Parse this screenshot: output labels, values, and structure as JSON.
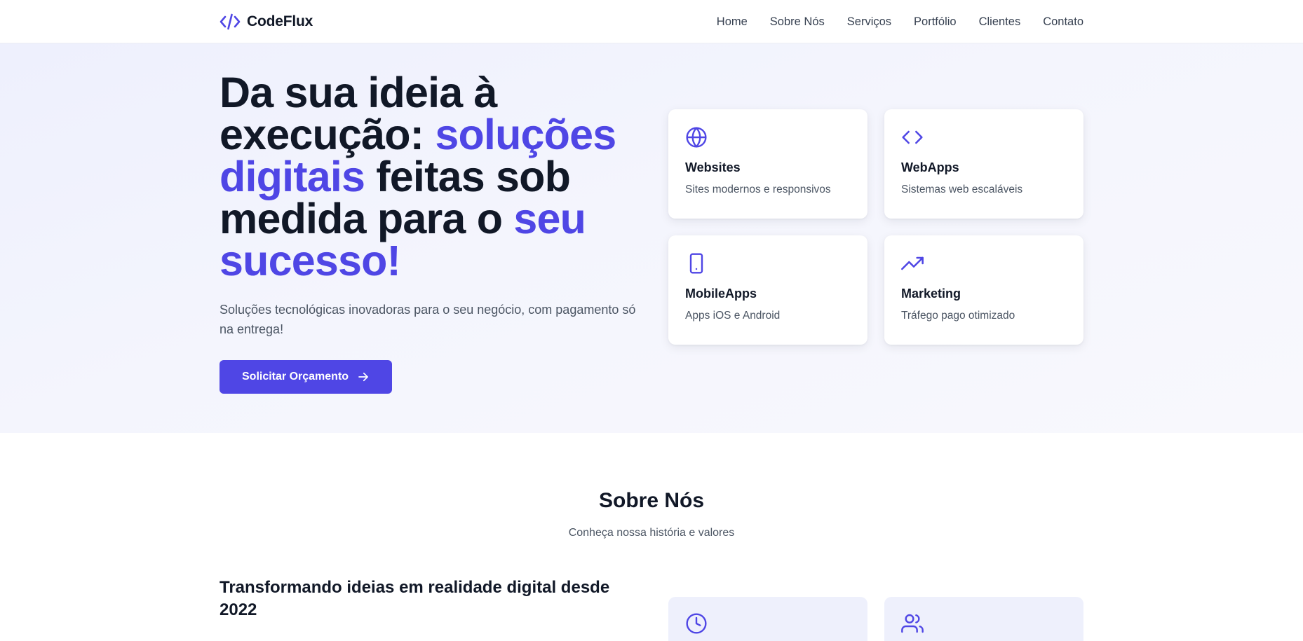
{
  "brand": {
    "name": "CodeFlux",
    "icon": "code-icon",
    "accent_color": "#4f46e5"
  },
  "nav": {
    "links": [
      {
        "label": "Home"
      },
      {
        "label": "Sobre Nós"
      },
      {
        "label": "Serviços"
      },
      {
        "label": "Portfólio"
      },
      {
        "label": "Clientes"
      },
      {
        "label": "Contato"
      }
    ]
  },
  "hero": {
    "headline": {
      "part1": "Da sua ideia à execução: ",
      "accent1": "soluções digitais",
      "part2": " feitas sob medida para o ",
      "accent2": "seu sucesso!"
    },
    "lead": "Soluções tecnológicas inovadoras para o seu negócio, com pagamento só na entrega!",
    "cta_label": "Solicitar Orçamento",
    "cta_icon": "arrow-right-icon"
  },
  "services": [
    {
      "icon": "globe-icon",
      "title": "Websites",
      "desc": "Sites modernos e responsivos"
    },
    {
      "icon": "code-icon",
      "title": "WebApps",
      "desc": "Sistemas web escaláveis"
    },
    {
      "icon": "smartphone-icon",
      "title": "MobileApps",
      "desc": "Apps iOS e Android"
    },
    {
      "icon": "trending-up-icon",
      "title": "Marketing",
      "desc": "Tráfego pago otimizado"
    }
  ],
  "about": {
    "title": "Sobre Nós",
    "subtitle": "Conheça nossa história e valores",
    "heading": "Transformando ideias em realidade digital desde 2022",
    "feature_icons": [
      "clock-icon",
      "users-icon"
    ]
  },
  "colors": {
    "primary": "#4f46e5",
    "text_dark": "#111827",
    "text_muted": "#4b5563",
    "hero_bg": "#eef0fd",
    "feature_bg": "#eef0fc"
  }
}
